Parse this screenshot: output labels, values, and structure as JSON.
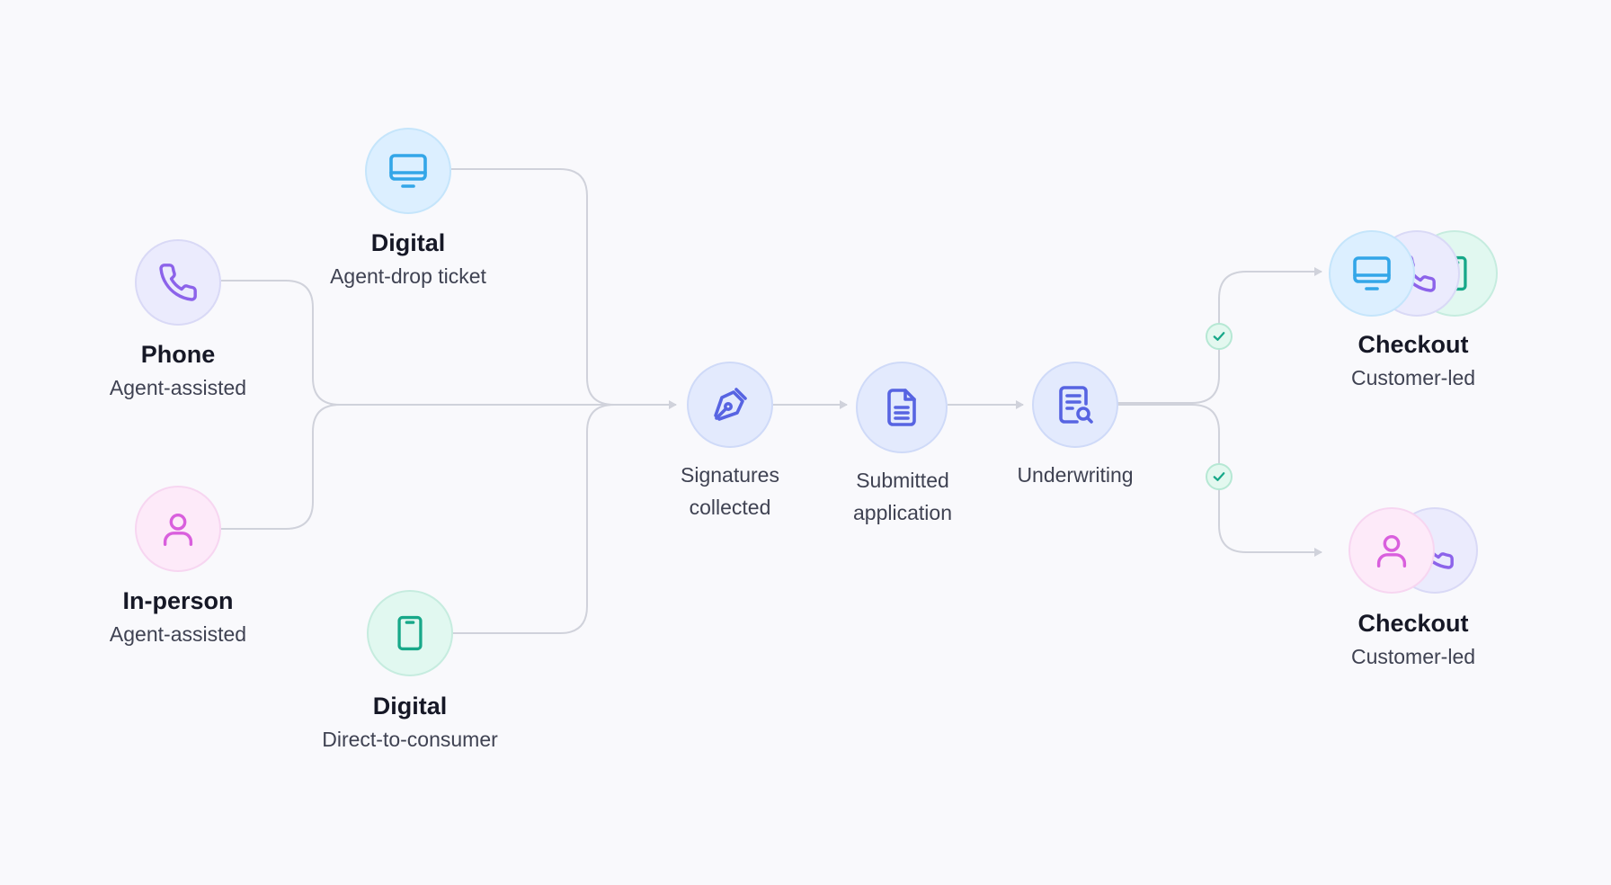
{
  "sources": {
    "phone": {
      "title": "Phone",
      "subtitle": "Agent-assisted",
      "icon": "phone-icon"
    },
    "digital_top": {
      "title": "Digital",
      "subtitle": "Agent-drop ticket",
      "icon": "monitor-icon"
    },
    "in_person": {
      "title": "In-person",
      "subtitle": "Agent-assisted",
      "icon": "person-icon"
    },
    "digital_bottom": {
      "title": "Digital",
      "subtitle": "Direct-to-consumer",
      "icon": "mobile-icon"
    }
  },
  "steps": {
    "signatures": {
      "line1": "Signatures",
      "line2": "collected",
      "icon": "pen-icon"
    },
    "submitted": {
      "line1": "Submitted",
      "line2": "application",
      "icon": "document-icon"
    },
    "underwriting": {
      "line1": "Underwriting",
      "icon": "document-search-icon"
    }
  },
  "outcomes": {
    "checkout_top": {
      "title": "Checkout",
      "subtitle": "Customer-led",
      "icons": [
        "monitor-icon",
        "phone-icon",
        "mobile-icon"
      ]
    },
    "checkout_bottom": {
      "title": "Checkout",
      "subtitle": "Customer-led",
      "icons": [
        "person-icon",
        "phone-icon"
      ]
    }
  },
  "badges": {
    "icon": "check-icon"
  },
  "colors": {
    "connector": "#d0d2db",
    "phone": "#8c63ea",
    "monitor": "#33a6e8",
    "person": "#d95fdd",
    "mobile": "#17a889",
    "step": "#5764e2",
    "check": "#17a889"
  }
}
